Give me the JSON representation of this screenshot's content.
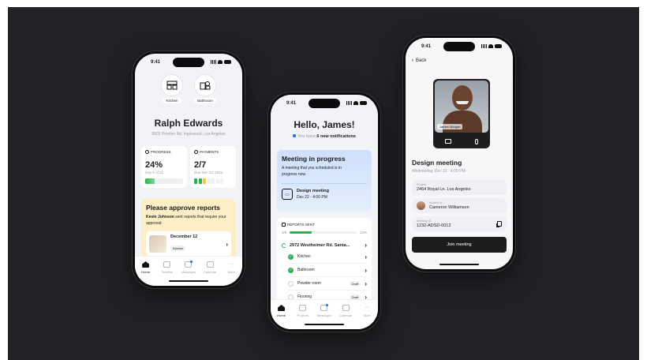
{
  "phone1": {
    "time": "9:41",
    "rooms": [
      {
        "label": "Kitchen",
        "icon": "kitchen-icon"
      },
      {
        "label": "Bathroom",
        "icon": "bathroom-icon"
      }
    ],
    "name": "Ralph Edwards",
    "address": "8502 Preston Rd. Inglewood, Los Angeles",
    "progress": {
      "label": "PROGRESS",
      "value": "24%",
      "sub": "Day 8 of 31",
      "fraction": 0.24
    },
    "payments": {
      "label": "PAYMENTS",
      "value": "2/7",
      "sub": "Due Dec 23, 2022"
    },
    "approve": {
      "title": "Please approve reports",
      "author": "Kevin Johnson",
      "text": "sent reports that require your approval:",
      "report_date": "December 12",
      "report_tag": "Kitchen"
    },
    "tabs": [
      "Home",
      "Timeline",
      "Messages",
      "Calendar",
      "More"
    ]
  },
  "phone2": {
    "time": "9:41",
    "greeting": "Hello, James!",
    "notif_prefix": "You have",
    "notif_count": "6 new notifications",
    "meeting": {
      "title": "Meeting in progress",
      "text": "A meeting that you scheduled is in progress now.",
      "name": "Design meeting",
      "date": "Dec 22 · 4:00 PM"
    },
    "reports": {
      "label": "REPORTS SENT",
      "count": "3/9",
      "percent": "33%",
      "fraction": 0.33,
      "address": "2972 Westheimer Rd. Santa...",
      "items": [
        {
          "label": "Kitchen",
          "done": true,
          "badge": ""
        },
        {
          "label": "Bathroom",
          "done": true,
          "badge": ""
        },
        {
          "label": "Powder room",
          "done": false,
          "badge": "Draft"
        },
        {
          "label": "Flooring",
          "done": false,
          "badge": "Draft"
        }
      ]
    },
    "tabs": [
      "Home",
      "Projects",
      "Messages",
      "Calendar",
      "More"
    ]
  },
  "phone3": {
    "time": "9:41",
    "back": "Back",
    "caller": "James Morgan",
    "title": "Design meeting",
    "datetime": "Wednesday, Dec 22 · 4:00 PM",
    "project_label": "Project",
    "project": "2464 Royal Ln. Los Angeles",
    "invited_label": "Invited by",
    "invited": "Cameron Williamson",
    "meeting_id_label": "Meeting ID",
    "meeting_id": "1232-ADSD-0012",
    "join": "Join meeting"
  },
  "colors": {
    "bg": "#222226",
    "accent_blue": "#1d6bf2",
    "green": "#2bb24c",
    "yellow_card": "#fdeec6",
    "blue_card": "#cfe0fb",
    "dark_button": "#1d1d1f"
  }
}
